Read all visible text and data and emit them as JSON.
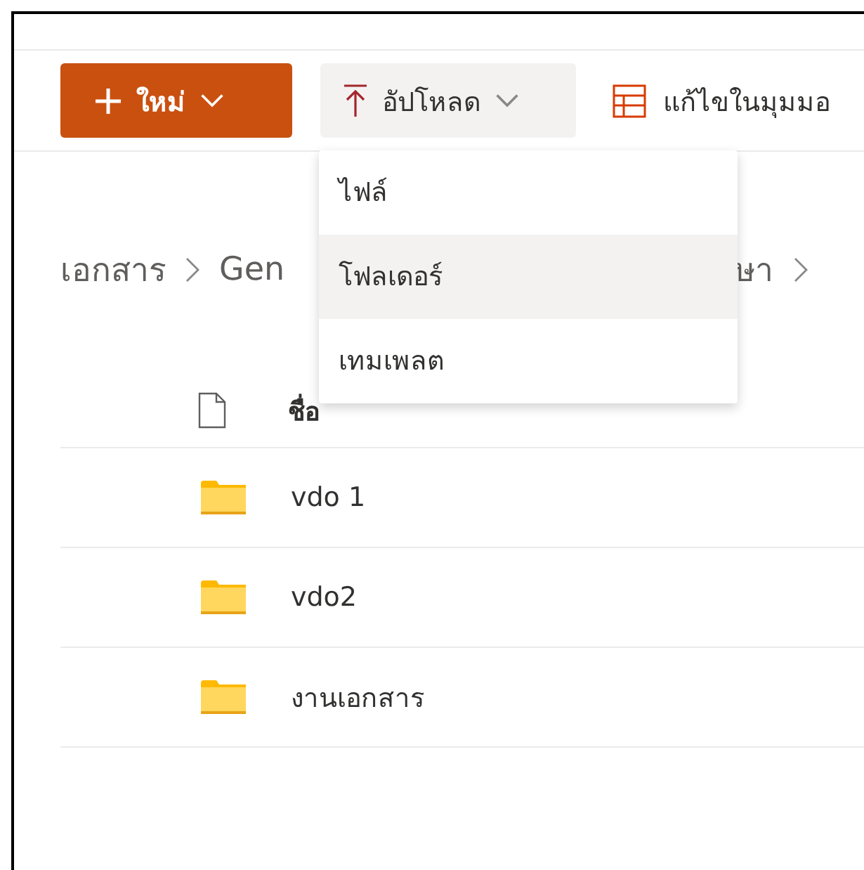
{
  "toolbar": {
    "new_button": {
      "label": "ใหม่"
    },
    "upload_button": {
      "label": "อัปโหลด",
      "expanded": true
    },
    "edit_grid_button": {
      "label": "แก้ไขในมุมมอ"
    }
  },
  "upload_menu": [
    {
      "label": "ไฟล์",
      "selected": false
    },
    {
      "label": "โฟลเดอร์",
      "selected": true
    },
    {
      "label": "เทมเพลต",
      "selected": false
    }
  ],
  "breadcrumb": [
    "เอกสาร",
    "Gen",
    "ษา"
  ],
  "file_list": {
    "columns": [
      "ชื่อ"
    ],
    "rows": [
      {
        "name": "vdo 1",
        "kind": "folder"
      },
      {
        "name": "vdo2",
        "kind": "folder"
      },
      {
        "name": "งานเอกสาร",
        "kind": "folder"
      }
    ]
  }
}
